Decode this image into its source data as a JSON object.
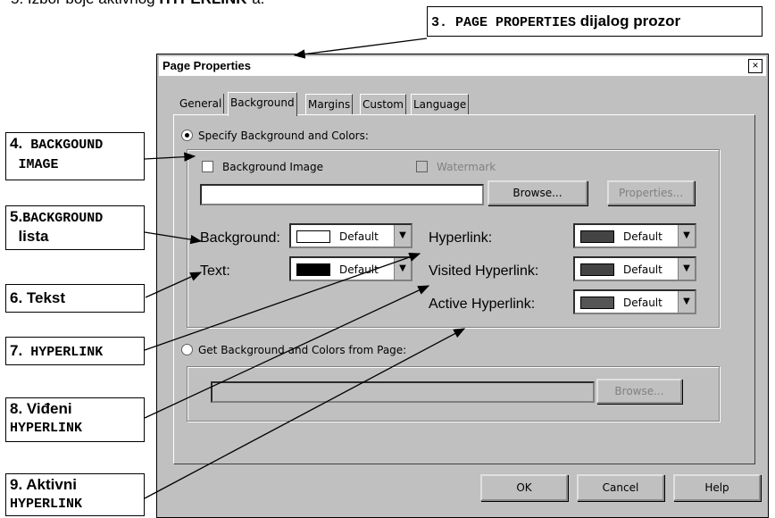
{
  "instruction": {
    "prefix": "5. Izbor boje aktivnog ",
    "bold": "HYPERLINK",
    "suffix": "-a."
  },
  "callouts": {
    "c3": {
      "mono": "3. PAGE PROPERTIES",
      "text": " dijalog prozor"
    },
    "c4": {
      "num": "4.",
      "mono1": " BACKGOUND",
      "mono2": "IMAGE"
    },
    "c5": {
      "num": "5.",
      "mono": "BACKGROUND",
      "text": "lista"
    },
    "c6": {
      "text": "6. Tekst"
    },
    "c7": {
      "num": "7.",
      "mono": " HYPERLINK"
    },
    "c8": {
      "text": "8. Viđeni",
      "mono": "HYPERLINK"
    },
    "c9": {
      "text": "9. Aktivni",
      "mono": "HYPERLINK"
    }
  },
  "dialog": {
    "title": "Page Properties",
    "close": "×",
    "tabs": [
      "General",
      "Background",
      "Margins",
      "Custom",
      "Language"
    ],
    "specify_radio": "Specify Background and Colors:",
    "bg_image_check": "Background Image",
    "watermark_check": "Watermark",
    "browse": "Browse...",
    "properties": "Properties...",
    "labels": {
      "background": "Background:",
      "text": "Text:",
      "hyperlink": "Hyperlink:",
      "visited": "Visited Hyperlink:",
      "active": "Active Hyperlink:"
    },
    "dropdowns": {
      "background": {
        "value": "Default",
        "color": "#ffffff"
      },
      "text": {
        "value": "Default",
        "color": "#000000"
      },
      "hyperlink": {
        "value": "Default",
        "color": "#444444"
      },
      "visited": {
        "value": "Default",
        "color": "#444444"
      },
      "active": {
        "value": "Default",
        "color": "#555555"
      }
    },
    "get_radio": "Get Background and Colors from Page:",
    "browse2": "Browse...",
    "ok": "OK",
    "cancel": "Cancel",
    "help": "Help"
  }
}
